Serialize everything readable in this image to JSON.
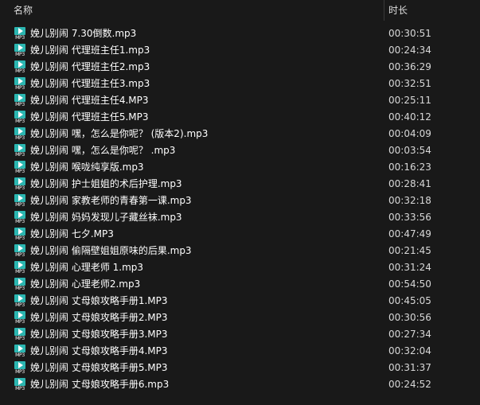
{
  "header": {
    "name_label": "名称",
    "duration_label": "时长",
    "sort_indicator": "^"
  },
  "icon": {
    "type": "mp3-audio-file-icon",
    "badge_text": "MP3",
    "color": "#2bb6b1"
  },
  "files": [
    {
      "name": "娩儿别闹 7.30倒数.mp3",
      "duration": "00:30:51"
    },
    {
      "name": "娩儿别闹 代理班主任1.mp3",
      "duration": "00:24:34"
    },
    {
      "name": "娩儿别闹 代理班主任2.mp3",
      "duration": "00:36:29"
    },
    {
      "name": "娩儿别闹 代理班主任3.mp3",
      "duration": "00:32:51"
    },
    {
      "name": "娩儿别闹 代理班主任4.MP3",
      "duration": "00:25:11"
    },
    {
      "name": "娩儿别闹 代理班主任5.MP3",
      "duration": "00:40:12"
    },
    {
      "name": "娩儿别闹 嘿，怎么是你呢？ (版本2).mp3",
      "duration": "00:04:09"
    },
    {
      "name": "娩儿别闹 嘿，怎么是你呢？ .mp3",
      "duration": "00:03:54"
    },
    {
      "name": "娩儿别闹 喉咙纯享版.mp3",
      "duration": "00:16:23"
    },
    {
      "name": "娩儿别闹 护士姐姐的术后护理.mp3",
      "duration": "00:28:41"
    },
    {
      "name": "娩儿别闹 家教老师的青春第一课.mp3",
      "duration": "00:32:18"
    },
    {
      "name": "娩儿别闹 妈妈发现儿子藏丝袜.mp3",
      "duration": "00:33:56"
    },
    {
      "name": "娩儿别闹 七夕.MP3",
      "duration": "00:47:49"
    },
    {
      "name": "娩儿别闹 偷隔壁姐姐原味的后果.mp3",
      "duration": "00:21:45"
    },
    {
      "name": "娩儿别闹 心理老师 1.mp3",
      "duration": "00:31:24"
    },
    {
      "name": "娩儿别闹 心理老师2.mp3",
      "duration": "00:54:50"
    },
    {
      "name": "娩儿别闹 丈母娘攻略手册1.MP3",
      "duration": "00:45:05"
    },
    {
      "name": "娩儿别闹 丈母娘攻略手册2.MP3",
      "duration": "00:30:56"
    },
    {
      "name": "娩儿别闹 丈母娘攻略手册3.MP3",
      "duration": "00:27:34"
    },
    {
      "name": "娩儿别闹 丈母娘攻略手册4.MP3",
      "duration": "00:32:04"
    },
    {
      "name": "娩儿别闹 丈母娘攻略手册5.MP3",
      "duration": "00:31:37"
    },
    {
      "name": "娩儿别闹 丈母娘攻略手册6.mp3",
      "duration": "00:24:52"
    }
  ]
}
